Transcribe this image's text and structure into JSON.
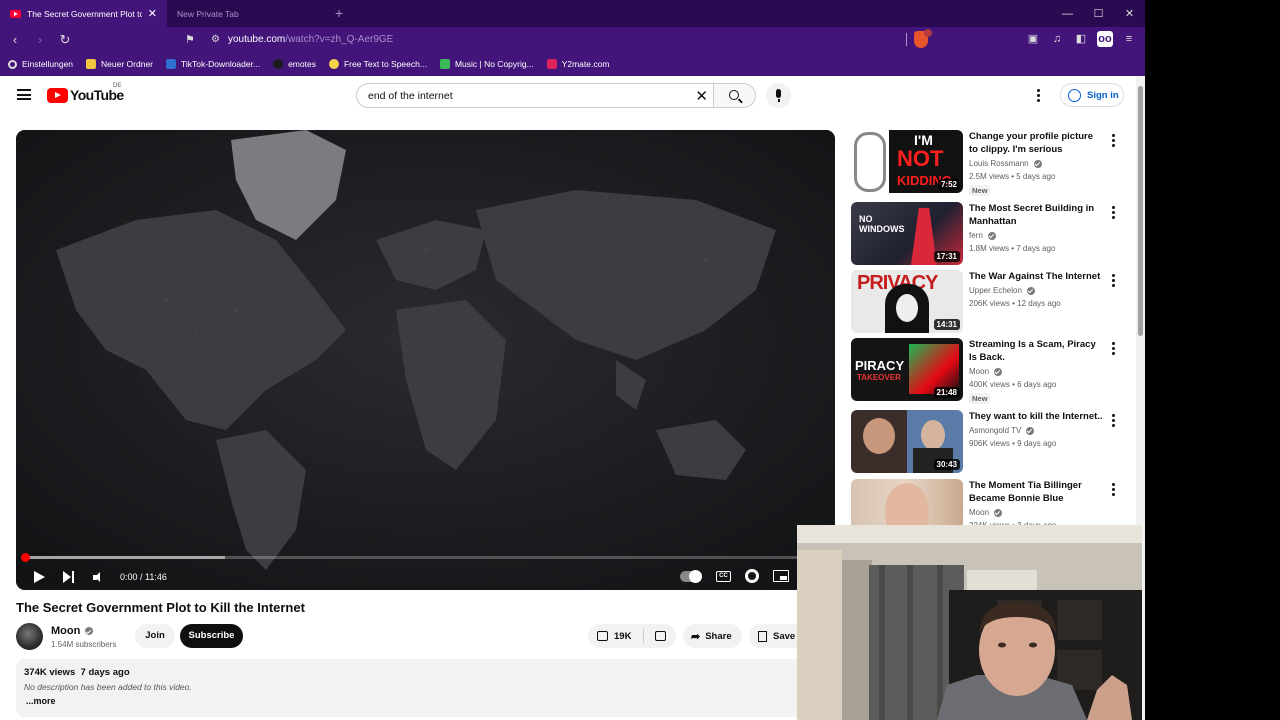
{
  "browser": {
    "tabs": [
      {
        "title": "The Secret Government Plot to Ki",
        "active": true
      },
      {
        "title": "New Private Tab",
        "active": false
      }
    ],
    "url": {
      "host": "youtube.com",
      "path": "/watch?v=zh_Q-Aer9GE"
    },
    "bookmarks": [
      {
        "label": "Einstellungen",
        "icon": "gear-icon"
      },
      {
        "label": "Neuer Ordner",
        "icon": "folder-icon"
      },
      {
        "label": "TikTok-Downloader...",
        "icon": "tiktok-icon"
      },
      {
        "label": "emotes",
        "icon": "emotes-icon"
      },
      {
        "label": "Free Text to Speech...",
        "icon": "tts-icon"
      },
      {
        "label": "Music | No Copyrig...",
        "icon": "music-icon"
      },
      {
        "label": "Y2mate.com",
        "icon": "y2mate-icon"
      }
    ]
  },
  "youtube": {
    "logo_text": "YouTube",
    "country_code": "DE",
    "search_value": "end of the internet",
    "sign_in_label": "Sign in"
  },
  "player": {
    "time_display": "0:00 / 11:46",
    "progress": 0.0,
    "buffered": 0.25,
    "cc_label": "CC"
  },
  "video": {
    "title": "The Secret Government Plot to Kill the Internet",
    "channel": "Moon",
    "subscribers": "1.54M subscribers",
    "join_label": "Join",
    "subscribe_label": "Subscribe",
    "likes": "19K",
    "share_label": "Share",
    "save_label": "Save",
    "views": "374K views",
    "age": "7 days ago",
    "description": "No description has been added to this video.",
    "more_label": "...more"
  },
  "recommendations": [
    {
      "title": "Change your profile picture to clippy. I'm serious",
      "channel": "Louis Rossmann",
      "views": "2.5M views • 5 days ago",
      "duration": "7:52",
      "badge": "New",
      "thumb_text": [
        "I'M",
        "NOT",
        "KIDDING"
      ]
    },
    {
      "title": "The Most Secret Building in Manhattan",
      "channel": "fern",
      "views": "1.8M views • 7 days ago",
      "duration": "17:31",
      "badge": "",
      "thumb_text": [
        "NO",
        "WINDOWS"
      ]
    },
    {
      "title": "The War Against The Internet",
      "channel": "Upper Echelon",
      "views": "206K views • 12 days ago",
      "duration": "14:31",
      "badge": "",
      "thumb_text": [
        "PRIVACY"
      ]
    },
    {
      "title": "Streaming Is a Scam, Piracy Is Back.",
      "channel": "Moon",
      "views": "400K views • 6 days ago",
      "duration": "21:48",
      "badge": "New",
      "thumb_text": [
        "PIRACY",
        "TAKEOVER"
      ]
    },
    {
      "title": "They want to kill the Internet..",
      "channel": "Asmongold TV",
      "views": "906K views • 9 days ago",
      "duration": "30:43",
      "badge": "",
      "thumb_text": []
    },
    {
      "title": "The Moment Tia Billinger Became Bonnie Blue",
      "channel": "Moon",
      "views": "224K views • 3 days ago",
      "duration": "",
      "badge": "",
      "thumb_text": []
    }
  ],
  "colors": {
    "browser_frame": "#43147a",
    "tab_strip": "#2a0b52",
    "youtube_red": "#ff0000",
    "link_blue": "#065fd4"
  }
}
